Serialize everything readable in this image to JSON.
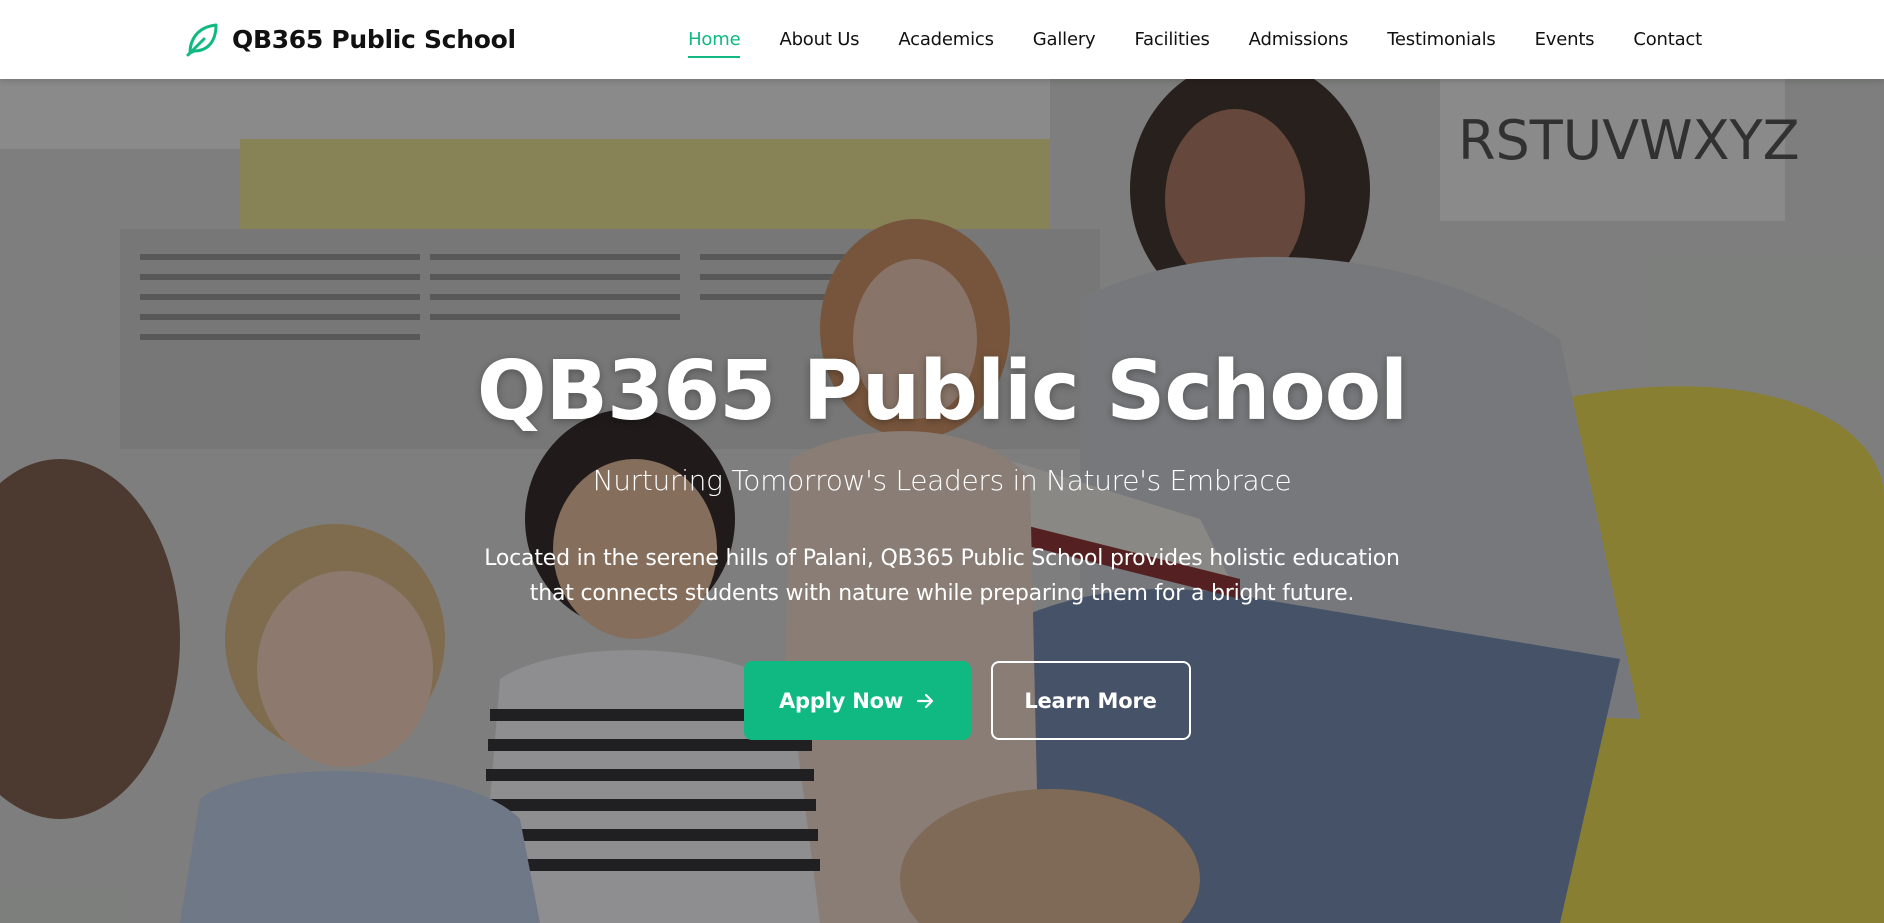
{
  "brand": {
    "name": "QB365 Public School",
    "logo_icon": "leaf-icon",
    "accent_color": "#10b981"
  },
  "nav": {
    "items": [
      {
        "label": "Home",
        "active": true
      },
      {
        "label": "About Us",
        "active": false
      },
      {
        "label": "Academics",
        "active": false
      },
      {
        "label": "Gallery",
        "active": false
      },
      {
        "label": "Facilities",
        "active": false
      },
      {
        "label": "Admissions",
        "active": false
      },
      {
        "label": "Testimonials",
        "active": false
      },
      {
        "label": "Events",
        "active": false
      },
      {
        "label": "Contact",
        "active": false
      }
    ]
  },
  "hero": {
    "title": "QB365 Public School",
    "subtitle": "Nurturing Tomorrow's Leaders in Nature's Embrace",
    "description_line1": "Located in the serene hills of Palani, QB365 Public School provides holistic education",
    "description_line2": "that connects students with nature while preparing them for a bright future.",
    "primary_button": {
      "label": "Apply Now",
      "icon": "arrow-right-icon"
    },
    "secondary_button": {
      "label": "Learn More"
    },
    "poster_text": "RSTUVWXYZ"
  }
}
